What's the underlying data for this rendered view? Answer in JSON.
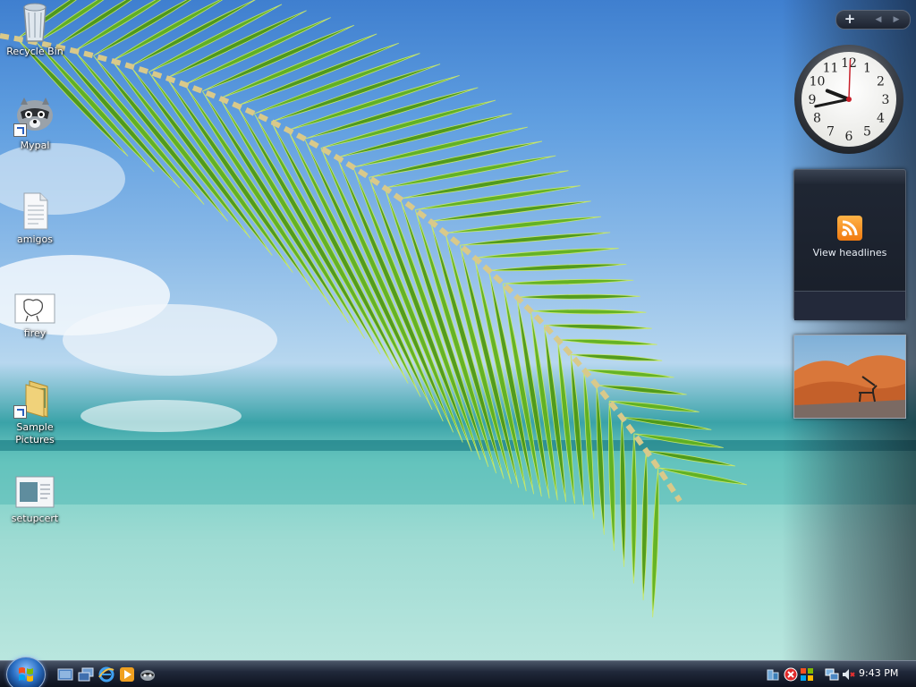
{
  "desktop_icons": [
    {
      "label": "Recycle Bin",
      "icon": "recycle-bin-icon"
    },
    {
      "label": "Mypal",
      "icon": "mypal-raccoon-icon"
    },
    {
      "label": "amigos",
      "icon": "text-file-icon"
    },
    {
      "label": "firey",
      "icon": "image-file-icon"
    },
    {
      "label": "Sample Pictures",
      "icon": "folder-icon"
    },
    {
      "label": "setupcert",
      "icon": "document-icon"
    }
  ],
  "sidebar": {
    "add_symbol": "+",
    "prev_symbol": "◀",
    "next_symbol": "▶",
    "clock": {
      "numerals": [
        "12",
        "1",
        "2",
        "3",
        "4",
        "5",
        "6",
        "7",
        "8",
        "9",
        "10",
        "11"
      ],
      "time": "9:43"
    },
    "feeds": {
      "label": "View headlines",
      "icon": "rss-feed-icon"
    },
    "slideshow": {
      "icon": "desert-oryx-photo"
    }
  },
  "taskbar": {
    "start_icon": "windows-start-orb",
    "quick_launch": [
      "show-desktop-icon",
      "switch-windows-icon",
      "internet-explorer-icon",
      "media-player-icon",
      "mypal-raccoon-icon"
    ],
    "tray_icons": [
      "network-icon",
      "security-alert-icon",
      "windows-update-icon",
      "network-connection-icon",
      "volume-muted-icon"
    ],
    "time": "9:43 PM"
  },
  "colors": {
    "taskbar": "#0c111c",
    "feed_orange": "#f07a10",
    "frond_green": "#5fae18"
  }
}
